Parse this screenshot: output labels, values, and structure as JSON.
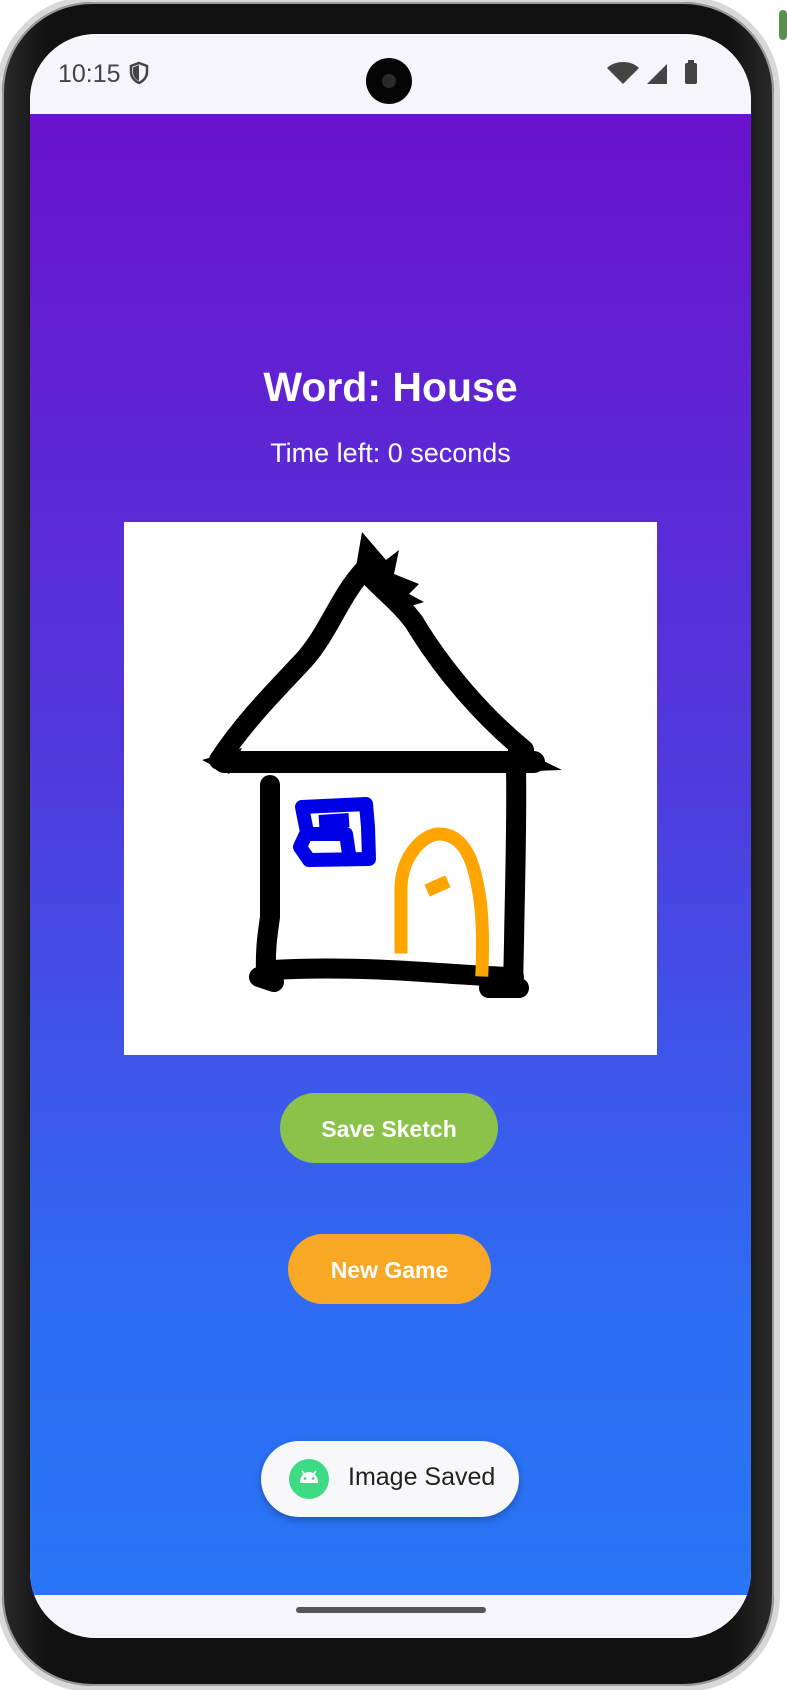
{
  "status_bar": {
    "time": "10:15",
    "shield_icon": "shield-icon",
    "wifi_icon": "wifi-icon",
    "signal_icon": "signal-icon",
    "battery_icon": "battery-icon"
  },
  "game": {
    "word_label": "Word: House",
    "time_left": "Time left: 0 seconds",
    "canvas_content": "house-sketch"
  },
  "buttons": {
    "save_label": "Save Sketch",
    "new_game_label": "New Game"
  },
  "toast": {
    "icon": "android-icon",
    "message": "Image Saved"
  },
  "colors": {
    "gradient_top": "#6a12cc",
    "gradient_bottom": "#2876f7",
    "save_button": "#8bc34a",
    "new_game_button": "#f9a825",
    "sketch_black": "#000000",
    "sketch_blue": "#0000e6",
    "sketch_orange": "#ffa500"
  }
}
